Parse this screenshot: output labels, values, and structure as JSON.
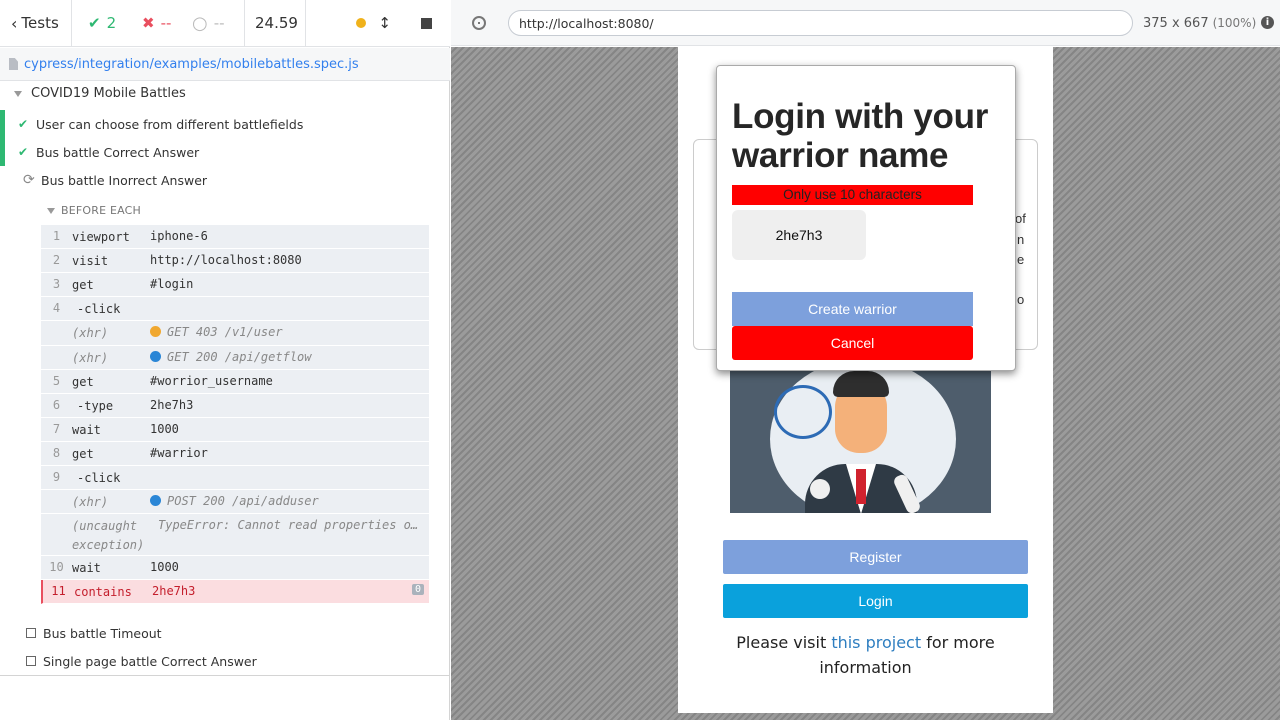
{
  "reporter": {
    "tests_label": "Tests",
    "passed": "2",
    "failed": "--",
    "pending": "--",
    "duration": "24.59",
    "spec_path": "cypress/integration/examples/mobilebattles.spec.js",
    "suite_title": "COVID19 Mobile Battles",
    "tests": [
      {
        "title": "User can choose from different battlefields",
        "state": "passed"
      },
      {
        "title": "Bus battle Correct Answer",
        "state": "passed"
      },
      {
        "title": "Bus battle Inorrect Answer",
        "state": "running"
      },
      {
        "title": "Bus battle Timeout",
        "state": "pending"
      },
      {
        "title": "Single page battle Correct Answer",
        "state": "pending"
      }
    ],
    "hook_label": "BEFORE EACH",
    "commands": [
      {
        "num": "1",
        "name": "viewport",
        "msg": "iphone-6"
      },
      {
        "num": "2",
        "name": "visit",
        "msg": "http://localhost:8080"
      },
      {
        "num": "3",
        "name": "get",
        "msg": "#login"
      },
      {
        "num": "4",
        "name": "-click",
        "msg": ""
      },
      {
        "num": "",
        "name": "(xhr)",
        "msg": "GET 403 /v1/user"
      },
      {
        "num": "",
        "name": "(xhr)",
        "msg": "GET 200 /api/getflow"
      },
      {
        "num": "5",
        "name": "get",
        "msg": "#worrior_username"
      },
      {
        "num": "6",
        "name": "-type",
        "msg": "2he7h3"
      },
      {
        "num": "7",
        "name": "wait",
        "msg": "1000"
      },
      {
        "num": "8",
        "name": "get",
        "msg": "#warrior"
      },
      {
        "num": "9",
        "name": "-click",
        "msg": ""
      },
      {
        "num": "",
        "name": "(xhr)",
        "msg": "POST 200 /api/adduser"
      },
      {
        "num": "",
        "name": "(uncaught exception)",
        "msg": "TypeError: Cannot read properties of undefined"
      },
      {
        "num": "10",
        "name": "wait",
        "msg": "1000"
      },
      {
        "num": "11",
        "name": "contains",
        "msg": "2he7h3",
        "badge": "0"
      }
    ],
    "colors": {
      "passed": "#2eb872",
      "failed": "#e94f5f",
      "xhr_403": "#f0a830",
      "xhr_200": "#2a86d6"
    }
  },
  "aut": {
    "url": "http://localhost:8080/",
    "viewport": "375 x 667",
    "zoom": "(100%)"
  },
  "app": {
    "card_fragments": [
      "of",
      "n",
      "e",
      "o"
    ],
    "register_label": "Register",
    "login_label": "Login",
    "visit_prefix": "Please visit ",
    "visit_link": "this project",
    "visit_suffix": " for more information",
    "modal": {
      "title": "Login with your warrior name",
      "hint": "Only use 10 characters",
      "input_value": "2he7h3",
      "create_label": "Create warrior",
      "cancel_label": "Cancel"
    }
  }
}
